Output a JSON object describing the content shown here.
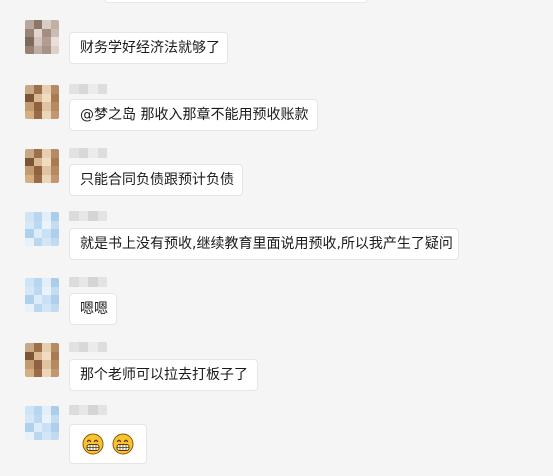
{
  "messages": [
    {
      "id": 1,
      "avatar": "warm",
      "text": "财务学好经济法就够了"
    },
    {
      "id": 2,
      "avatar": "amber",
      "text": "@梦之岛 那收入那章不能用预收账款"
    },
    {
      "id": 3,
      "avatar": "amber",
      "text": "只能合同负债跟预计负债"
    },
    {
      "id": 4,
      "avatar": "blue",
      "text": "就是书上没有预收,继续教育里面说用预收,所以我产生了疑问"
    },
    {
      "id": 5,
      "avatar": "blue",
      "text": "嗯嗯"
    },
    {
      "id": 6,
      "avatar": "amber",
      "text": "那个老师可以拉去打板子了"
    },
    {
      "id": 7,
      "avatar": "blue",
      "emojis": [
        "grinning-face-emoji",
        "grinning-face-emoji"
      ]
    }
  ],
  "colors": {
    "background": "#f5f5f5",
    "bubble": "#ffffff",
    "bubble_border": "#e6e6e6",
    "text": "#1a1a1a",
    "emoji_face": "#f8c232",
    "emoji_outline": "#8a5a00"
  }
}
